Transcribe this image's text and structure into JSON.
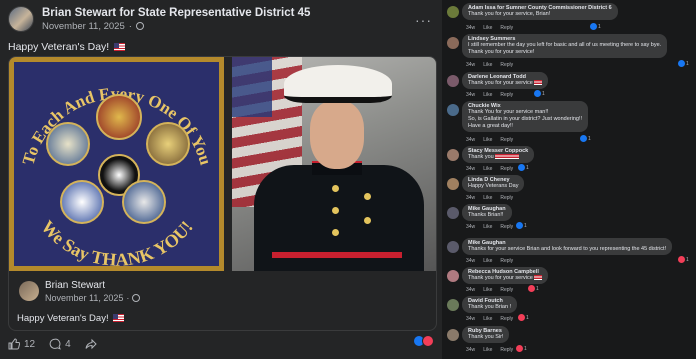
{
  "post": {
    "author": "Brian Stewart for State Representative District 45",
    "date": "November 11, 2025",
    "dot": "·",
    "text": "Happy Veteran's Day!",
    "more": "···",
    "image_left_text_top": "To Each And Every One Of You",
    "image_left_text_bottom": "We Say THANK YOU!",
    "shared": {
      "author": "Brian Stewart",
      "date": "November 11, 2025",
      "text": "Happy Veteran's Day!"
    },
    "actions": {
      "like_count": "12",
      "comment_count": "4"
    }
  },
  "comments": [
    {
      "name": "Adam Issa for Sumner County Commissioner District 6",
      "lines": [
        "Thank you for your service, Brian!"
      ],
      "time": "34w",
      "like": "Like",
      "reply": "Reply",
      "react_count": "1",
      "avatar_color": "#6b7a3a"
    },
    {
      "name": "Lindsey Summers",
      "lines": [
        "I still remember the day you left for basic and all of us meeting there to say bye.",
        "Thank you for your service!"
      ],
      "time": "34w",
      "like": "Like",
      "reply": "Reply",
      "react_count": "1",
      "avatar_color": "#8a6a5a"
    },
    {
      "name": "Darlene Leonard Todd",
      "lines": [
        "Thank you for your service"
      ],
      "time": "34w",
      "like": "Like",
      "reply": "Reply",
      "react_count": "1",
      "avatar_color": "#7a5a6a"
    },
    {
      "name": "Chuckie Wix",
      "lines": [
        "Thank You for your service man!!",
        "So, is Gallatin in your district? Just wondering!!",
        "Have a great day!!"
      ],
      "time": "34w",
      "like": "Like",
      "reply": "Reply",
      "react_count": "1",
      "avatar_color": "#4a6a8a"
    },
    {
      "name": "Stacy Messer Coppock",
      "lines": [
        "Thank you"
      ],
      "time": "34w",
      "like": "Like",
      "reply": "Reply",
      "react_count": "1",
      "avatar_color": "#9a7a6a"
    },
    {
      "name": "Linda D Cheney",
      "lines": [
        "Happy Veterans Day"
      ],
      "time": "34w",
      "like": "Like",
      "reply": "Reply",
      "react_count": "",
      "avatar_color": "#a08060"
    },
    {
      "name": "Mike Gaughan",
      "lines": [
        "Thanks Brian!!"
      ],
      "time": "34w",
      "like": "Like",
      "reply": "Reply",
      "react_count": "1",
      "avatar_color": "#5a5a6a"
    },
    {
      "name": "Mike Gaughan",
      "lines": [
        "Thanks for your service Brian and look forward to you representing the 45 district!"
      ],
      "time": "34w",
      "like": "Like",
      "reply": "Reply",
      "react_count": "1",
      "avatar_color": "#5a5a6a"
    },
    {
      "name": "Rebecca Hudson Campbell",
      "lines": [
        "Thank you for your service"
      ],
      "time": "34w",
      "like": "Like",
      "reply": "Reply",
      "react_count": "1",
      "avatar_color": "#b07a80"
    },
    {
      "name": "David Foutch",
      "lines": [
        "Thank you Brian !"
      ],
      "time": "34w",
      "like": "Like",
      "reply": "Reply",
      "react_count": "1",
      "avatar_color": "#6a7a5a"
    },
    {
      "name": "Ruby Barnes",
      "lines": [
        "Thank you Sir!"
      ],
      "time": "34w",
      "like": "Like",
      "reply": "Reply",
      "react_count": "1",
      "avatar_color": "#8a7a6a"
    }
  ]
}
